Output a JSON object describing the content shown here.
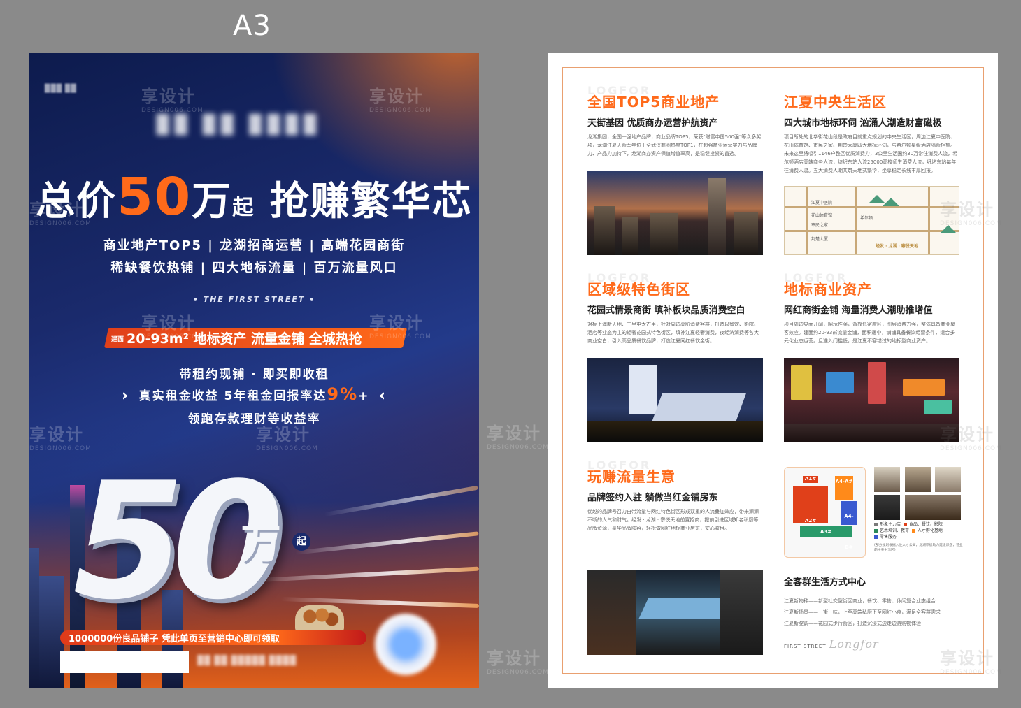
{
  "size_label": "A3",
  "poster": {
    "headline": {
      "prefix": "总价",
      "number": "50",
      "unit": "万",
      "suffix_small": "起",
      "rest": "抢赚繁华芯"
    },
    "features": [
      "商业地产TOP5 | 龙湖招商运营 | 高端花园商街",
      "稀缺餐饮热铺 | 四大地标流量 | 百万流量风口"
    ],
    "tagline": "• THE FIRST STREET •",
    "banner": {
      "small": "建面",
      "text": "20-93m² 地标资产 流量金铺 全城热抢"
    },
    "income": {
      "line1": "带租约现铺 · 即买即收租",
      "line2_prefix": "真实租金收益 5年租金回报率达",
      "line2_pct": "9%",
      "line2_suffix": "+",
      "line3": "领跑存款理财等收益率"
    },
    "big_number": "50",
    "big_unit": "万",
    "big_qi": "起",
    "gift": "1000000份良品铺子 凭此单页至营销中心即可领取"
  },
  "watermark": {
    "text": "享设计",
    "sub": "DESIGN006.COM"
  },
  "page": {
    "sections": [
      {
        "ghost": "LOGFOR",
        "title": "全国TOP5商业地产",
        "subtitle": "天街基因 优质商办运营护航资产",
        "body": "龙湖集团，全国十强地产品牌，商业品牌TOP5，荣获\"财富中国500强\"等众多奖项，龙湖江夏天街军年位于全武汉商圈热度TOP1，在超强商业运营实力与品牌力、产品力加持下，龙湖商办资产保值增值率高，是稳健投资的首选。"
      },
      {
        "ghost": "",
        "title": "江夏中央生活区",
        "subtitle": "四大城市地标环伺 汹涌人潮造财富磁极",
        "body": "项目所处的北华街花山段是政府目前重点规划的中央生活区，周边江夏中医院、花山体育馆、市民之家、荆楚大厦四大地标环伺，与希尔顿星级酒店隔街相望。未来这里将吸引1146户整区优质消费力，3公里生活圈约30万常住消费人流，希尔顿酒店高端商务人流，纺织东站人流25000高校师生消费人流，纸坊东站每年往消费人流。五大消费人潮共筑天地式繁华，坐享稳定长线丰厚回报。"
      },
      {
        "ghost": "LOGFOR",
        "title": "区域级特色街区",
        "subtitle": "花园式情景商街 填补板块品质消费空白",
        "body": "对标上海新天地、三里屯太古里，针对周边高阶消费客群，打造以餐饮、影院、酒店等业态为主的轻奢花园式特色街区，填补江夏轻奢消费，夜经济消费等各大商业空白，引入高品质餐饮品牌，打造江夏网红餐饮金街。"
      },
      {
        "ghost": "LOGFOR",
        "title": "地标商业资产",
        "subtitle": "网红商街金铺 海量消费人潮助推增值",
        "body": "项目周边界面开阔，昭示性强，背靠低密度区，图层消费力强，整体具备商业聚客效应。建面约20-93㎡流量金铺，面积适中，铺铺具备餐饮经营条件，适合多元化业态运营。且准入门槛低，是江夏不容错过的地标型商业资产。"
      },
      {
        "ghost": "LOGFOR",
        "title": "玩赚流量生意",
        "subtitle": "品牌签约入驻 躺做当红金铺房东",
        "body": "优越的品牌号召力自带流量与网红特色街区形成双重的人流叠加效应，带来源源不断的人气和财气。经发 · 龙湖 · 寨悦天地前置招商，提前引进区域知名私厨等品牌资源，豪华品牌阵容，轻松做网红地标商业房东，安心收租。"
      }
    ],
    "map_labels": [
      "江夏中医院",
      "花山体育馆",
      "市民之家",
      "荆楚大厦",
      "希尔顿",
      "经发 · 龙湖 · 寨悦天地"
    ],
    "siteplan_blocks": [
      "A1#",
      "A2#",
      "A3#",
      "A4-A#",
      "A4-B#"
    ],
    "legend": [
      {
        "label": "形象主力店",
        "color": "#7a7a7a"
      },
      {
        "label": "食品、餐饮、影院",
        "color": "#e0401a"
      },
      {
        "label": "艺术培训、教育",
        "color": "#2a8a5a"
      },
      {
        "label": "人才孵化基地",
        "color": "#ff8a1a"
      },
      {
        "label": "零售服务",
        "color": "#3a5ad0"
      }
    ],
    "legend_note": "(部分规划根据入驻人才公寓，龙湖积极助力建设课题，营业的中央生活区)",
    "lifestyle": {
      "title": "全客群生活方式中心",
      "lines": [
        "江夏新物种——新型社交型街区商业，餐饮、零售、休闲复合业态组合",
        "江夏新场景——一街一味，上至高端私厨下至网红小食，满足全客群需求",
        "江夏新腔调——花园式步行街区，打造沉浸式边走边游购物体验"
      ]
    },
    "footer_brand": "FIRST STREET",
    "footer_sig": "Longfor"
  }
}
